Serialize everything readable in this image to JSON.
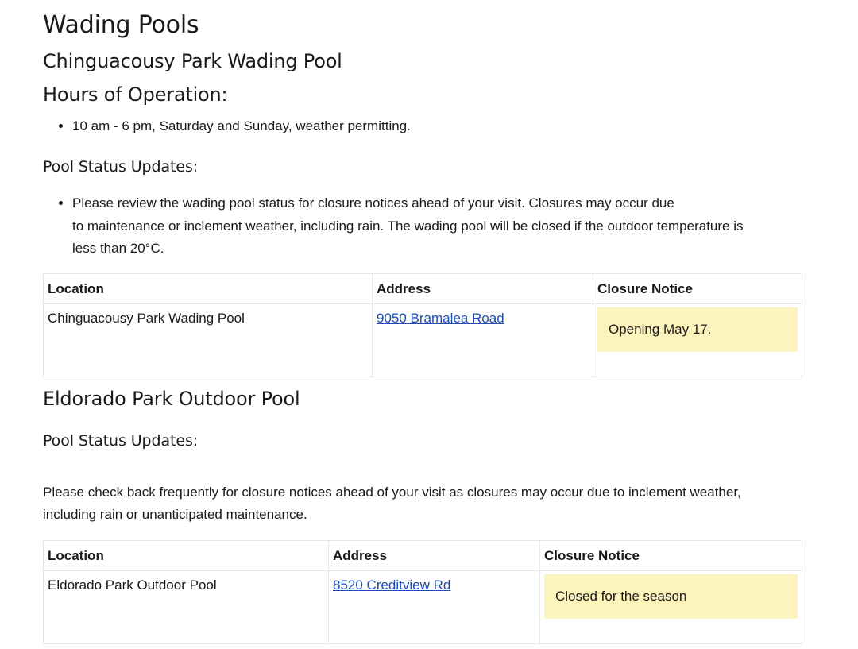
{
  "page_title": "Wading Pools",
  "chinguacousy": {
    "heading": "Chinguacousy Park Wading Pool",
    "hours_heading": "Hours of Operation:",
    "hours": [
      "10 am - 6 pm, Saturday and Sunday, weather permitting."
    ],
    "status_heading": "Pool Status Updates:",
    "status_bullet": {
      "line1": "Please review the wading pool status for closure notices ahead of your visit. Closures may occur due",
      "line2": "to maintenance or inclement weather, including rain. The wading pool will be closed if the outdoor temperature is",
      "line3": "less than 20°C."
    },
    "table": {
      "headers": [
        "Location",
        "Address",
        "Closure Notice"
      ],
      "row": {
        "location": "Chinguacousy Park Wading Pool",
        "address": "9050 Bramalea Road",
        "notice": "Opening May 17."
      }
    }
  },
  "eldorado": {
    "heading": "Eldorado Park Outdoor Pool",
    "status_heading": "Pool Status Updates:",
    "status_text": {
      "line1": "Please check back frequently for closure notices ahead of your visit as closures may occur due to inclement weather,",
      "line2": "including rain or unanticipated maintenance."
    },
    "table": {
      "headers": [
        "Location",
        "Address",
        "Closure Notice"
      ],
      "row": {
        "location": "Eldorado Park Outdoor Pool",
        "address": "8520 Creditview Rd",
        "notice": "Closed for the season"
      }
    }
  },
  "colors": {
    "link": "#1b4fb8",
    "notice_background": "#fdf4bd",
    "table_border": "#e6e6e6"
  }
}
